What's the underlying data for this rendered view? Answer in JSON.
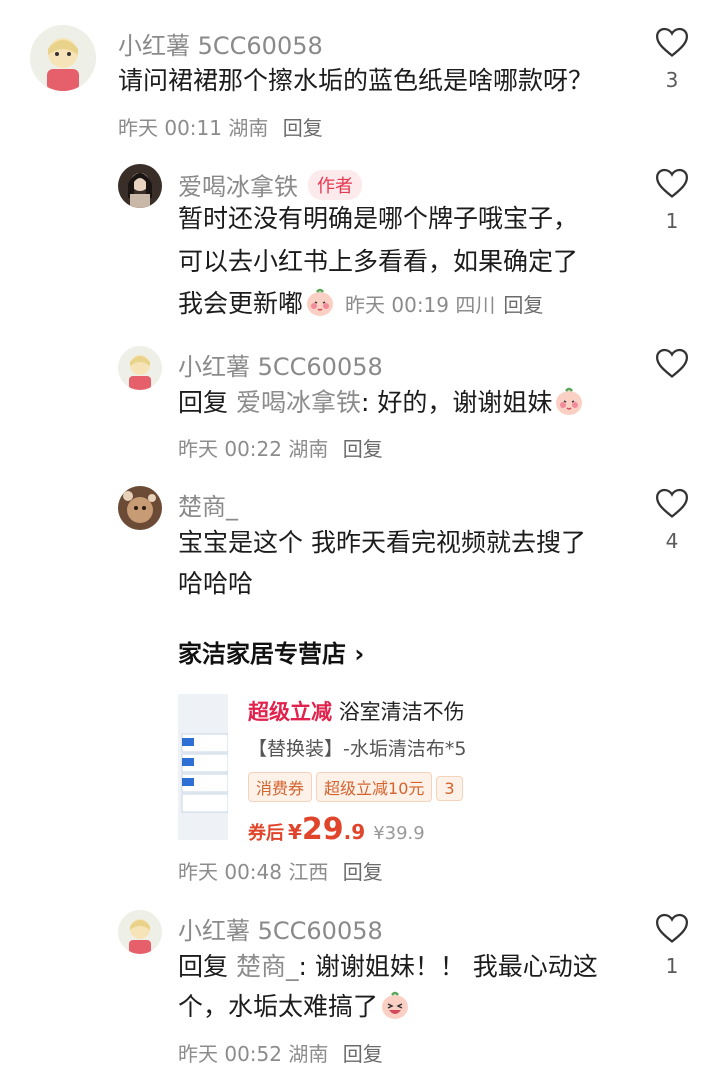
{
  "colors": {
    "accent": "#e63950",
    "meta": "#8c8c8c",
    "price": "#e0452c"
  },
  "comments": [
    {
      "username": "小红薯 5CC60058",
      "lines": [
        "请问裙裙那个擦水垢的蓝色纸是啥哪款呀？"
      ],
      "time": "昨天 00:11",
      "location": "湖南",
      "reply_label": "回复",
      "like_count": "3"
    },
    {
      "username": "爱喝冰拿铁",
      "badge": "作者",
      "lines": [
        "暂时还没有明确是哪个牌子哦宝子，",
        "可以去小红书上多看看，如果确定了",
        "我会更新嘟"
      ],
      "time": "昨天 00:19",
      "location": "四川",
      "reply_label": "回复",
      "like_count": "1",
      "emoji": "shy-blush-emoji"
    },
    {
      "username": "小红薯 5CC60058",
      "reply_prefix": "回复",
      "reply_target": "爱喝冰拿铁",
      "text": ": 好的，谢谢姐妹",
      "time": "昨天 00:22",
      "location": "湖南",
      "reply_label": "回复",
      "like_count": "",
      "emoji": "shy-blush-emoji"
    },
    {
      "username": "楚商_",
      "lines": [
        "宝宝是这个 我昨天看完视频就去搜了",
        "哈哈哈"
      ],
      "time": "昨天 00:48",
      "location": "江西",
      "reply_label": "回复",
      "like_count": "4",
      "product": {
        "shop": "家洁家居专营店 ›",
        "title_highlight": "超级立减",
        "title": "浴室清洁不伤",
        "subtitle": "【替换装】-水垢清洁布*5",
        "tags": [
          "消费券",
          "超级立减10元",
          "3"
        ],
        "price_prefix": "券后",
        "currency": "¥",
        "price_int": "29",
        "price_dec": ".9",
        "original_price": "¥39.9"
      }
    },
    {
      "username": "小红薯 5CC60058",
      "reply_prefix": "回复",
      "reply_target": "楚商_",
      "text": ": 谢谢姐妹！！ 我最心动这",
      "line2": "个，水垢太难搞了",
      "time": "昨天 00:52",
      "location": "湖南",
      "reply_label": "回复",
      "like_count": "1",
      "emoji": "laughing-emoji"
    }
  ]
}
